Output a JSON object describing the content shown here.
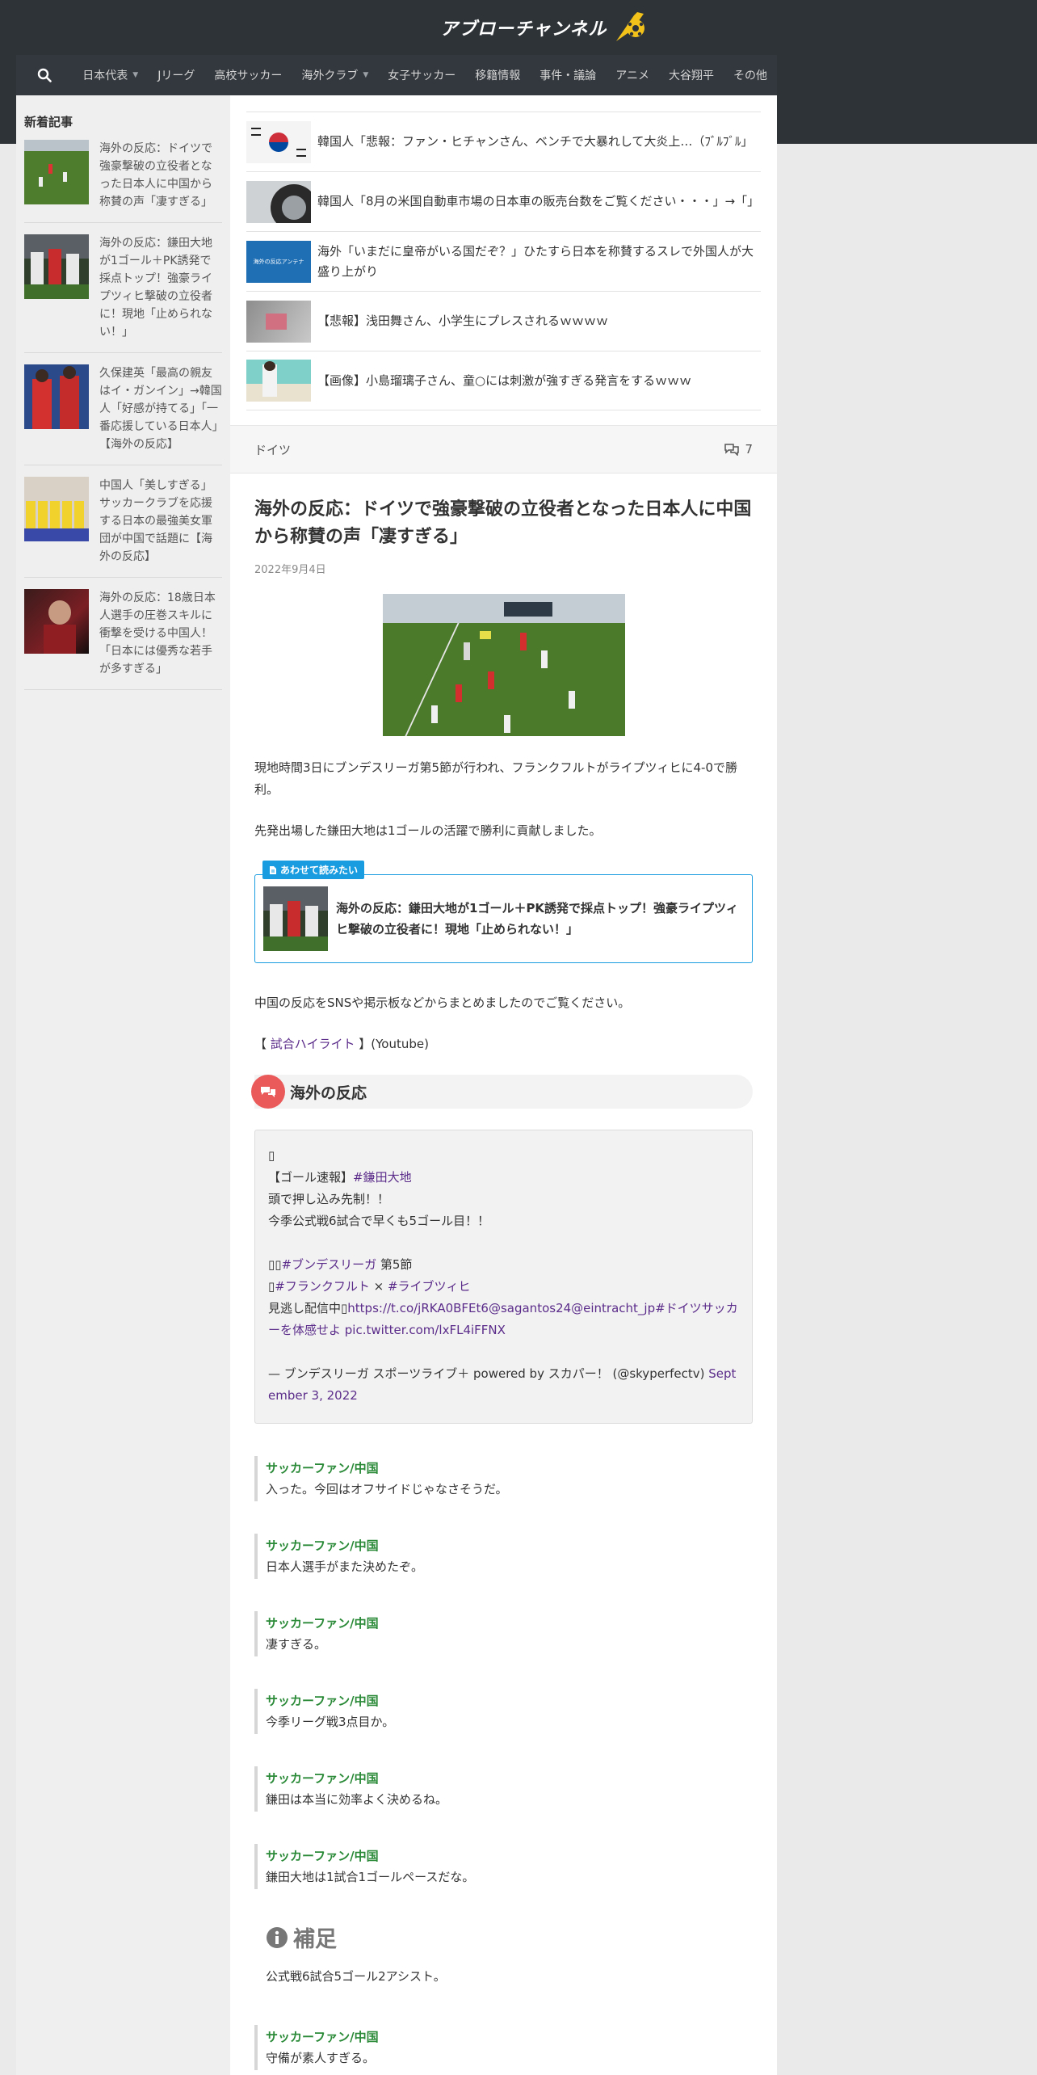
{
  "site": {
    "logo_text": "アブローチャンネル"
  },
  "nav": {
    "items": [
      {
        "label": "日本代表",
        "dropdown": true
      },
      {
        "label": "Jリーグ",
        "dropdown": false
      },
      {
        "label": "高校サッカー",
        "dropdown": false
      },
      {
        "label": "海外クラブ",
        "dropdown": true
      },
      {
        "label": "女子サッカー",
        "dropdown": false
      },
      {
        "label": "移籍情報",
        "dropdown": false
      },
      {
        "label": "事件・議論",
        "dropdown": false
      },
      {
        "label": "アニメ",
        "dropdown": false
      },
      {
        "label": "大谷翔平",
        "dropdown": false
      },
      {
        "label": "その他",
        "dropdown": false
      }
    ]
  },
  "sidebar": {
    "title": "新着記事",
    "items": [
      {
        "title": "海外の反応：ドイツで強豪撃破の立役者となった日本人に中国から称賛の声「凄すぎる」"
      },
      {
        "title": "海外の反応：鎌田大地が1ゴール＋PK誘発で採点トップ！強豪ライプツィヒ撃破の立役者に！現地「止められない！」"
      },
      {
        "title": "久保建英「最高の親友はイ・ガンイン」→韓国人「好感が持てる」「一番応援している日本人」【海外の反応】"
      },
      {
        "title": "中国人「美しすぎる」サッカークラブを応援する日本の最強美女軍団が中国で話題に【海外の反応】"
      },
      {
        "title": "海外の反応：18歳日本人選手の圧巻スキルに衝撃を受ける中国人！「日本には優秀な若手が多すぎる」"
      }
    ]
  },
  "related": [
    {
      "title": "韓国人「悲報：ファン・ヒチャンさん、ベンチで大暴れして大炎上…（ﾌﾞﾙﾌﾞﾙ」"
    },
    {
      "title": "韓国人「8月の米国自動車市場の日本車の販売台数をご覧ください・・・」→「」"
    },
    {
      "title": "海外「いまだに皇帝がいる国だぞ？」ひたすら日本を称賛するスレで外国人が大盛り上がり",
      "thumb_label": "海外の反応アンテナ"
    },
    {
      "title": "【悲報】浅田舞さん、小学生にプレスされるｗｗｗｗ"
    },
    {
      "title": "【画像】小島瑠璃子さん、童○には刺激が強すぎる発言をするｗｗｗ"
    }
  ],
  "category": {
    "label": "ドイツ",
    "comment_count": "7"
  },
  "article": {
    "title": "海外の反応：ドイツで強豪撃破の立役者となった日本人に中国から称賛の声「凄すぎる」",
    "date": "2022年9月4日",
    "para1": "現地時間3日にブンデスリーガ第5節が行われ、フランクフルトがライプツィヒに4-0で勝利。",
    "para2": "先発出場した鎌田大地は1ゴールの活躍で勝利に貢献しました。",
    "read_also": {
      "badge": "あわせて読みたい",
      "title": "海外の反応：鎌田大地が1ゴール＋PK誘発で採点トップ！強豪ライプツィヒ撃破の立役者に！現地「止められない！」"
    },
    "para3": "中国の反応をSNSや掲示板などからまとめましたのでご覧ください。",
    "highlight": {
      "prefix": "【 ",
      "link": "試合ハイライト",
      "suffix": " 】(Youtube)"
    },
    "section_heading": "海外の反応",
    "tweet": {
      "line0": "",
      "line1_prefix": "【ゴール速報】",
      "line1_tag": "#鎌田大地",
      "line2": "頭で押し込み先制！！",
      "line3": "今季公式戦6試合で早くも5ゴール目！！",
      "line4_prefix": "",
      "line4_tag": "#ブンデスリーガ",
      "line4_suffix": " 第5節",
      "line5_prefix": "",
      "line5_tag1": "#フランクフルト",
      "line5_mid": " × ",
      "line5_tag2": "#ライブツィヒ",
      "line6_prefix": "見逃し配信中",
      "line6_link": "https://t.co/jRKA0BFEt6@sagantos24@eintracht_jp#ドイツサッカーを体感せよ pic.twitter.com/lxFL4iFFNX",
      "attribution": "— ブンデスリーガ スポーツライブ＋ powered by スカパー！ (@skyperfectv) ",
      "attribution_date": "September 3, 2022"
    },
    "comments_before": [
      {
        "author": "サッカーファン/中国",
        "text": "入った。今回はオフサイドじゃなさそうだ。"
      },
      {
        "author": "サッカーファン/中国",
        "text": "日本人選手がまた決めたぞ。"
      },
      {
        "author": "サッカーファン/中国",
        "text": "凄すぎる。"
      },
      {
        "author": "サッカーファン/中国",
        "text": "今季リーグ戦3点目か。"
      },
      {
        "author": "サッカーファン/中国",
        "text": "鎌田は本当に効率よく決めるね。"
      },
      {
        "author": "サッカーファン/中国",
        "text": "鎌田大地は1試合1ゴールペースだな。"
      }
    ],
    "supplement": {
      "title": "補足",
      "text": "公式戦6試合5ゴール2アシスト。"
    },
    "comments_after": [
      {
        "author": "サッカーファン/中国",
        "text": "守備が素人すぎる。"
      }
    ]
  }
}
